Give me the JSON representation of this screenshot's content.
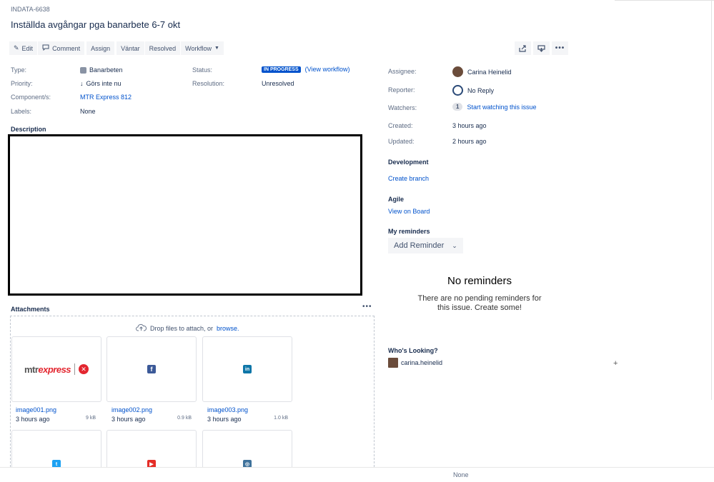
{
  "issue": {
    "key": "INDATA-6638",
    "title": "Inställda avgångar pga banarbete 6-7 okt"
  },
  "toolbar": {
    "edit": "Edit",
    "comment": "Comment",
    "assign": "Assign",
    "vantar": "Väntar",
    "resolved": "Resolved",
    "workflow": "Workflow"
  },
  "details": {
    "type_label": "Type:",
    "type_value": "Banarbeten",
    "priority_label": "Priority:",
    "priority_value": "Görs inte nu",
    "components_label": "Component/s:",
    "components_value": "MTR Express 812",
    "labels_label": "Labels:",
    "labels_value": "None",
    "status_label": "Status:",
    "status_value": "IN PROGRESS",
    "view_workflow": "(View workflow)",
    "resolution_label": "Resolution:",
    "resolution_value": "Unresolved"
  },
  "description": {
    "title": "Description"
  },
  "attachments": {
    "title": "Attachments",
    "drop_text": "Drop files to attach, or",
    "browse": "browse.",
    "files": [
      {
        "name": "image001.png",
        "time": "3 hours ago",
        "size": "9 kB",
        "logo": "mtr express"
      },
      {
        "name": "image002.png",
        "time": "3 hours ago",
        "size": "0.9 kB",
        "logo": "f"
      },
      {
        "name": "image003.png",
        "time": "3 hours ago",
        "size": "1.0 kB",
        "logo": "in"
      }
    ]
  },
  "people": {
    "assignee_label": "Assignee:",
    "assignee": "Carina Heinelid",
    "reporter_label": "Reporter:",
    "reporter": "No Reply",
    "watchers_label": "Watchers:",
    "watchers_count": "1",
    "watch_link": "Start watching this issue"
  },
  "dates": {
    "created_label": "Created:",
    "created": "3 hours ago",
    "updated_label": "Updated:",
    "updated": "2 hours ago"
  },
  "development": {
    "title": "Development",
    "create_branch": "Create branch"
  },
  "agile": {
    "title": "Agile",
    "view_on_board": "View on Board"
  },
  "reminders": {
    "title": "My reminders",
    "add_button": "Add Reminder",
    "empty_title": "No reminders",
    "empty_text": "There are no pending reminders for this issue. Create some!"
  },
  "whos_looking": {
    "title": "Who's Looking?",
    "viewer": "carina.heinelid"
  },
  "footer": {
    "none": "None"
  },
  "colors": {
    "status": "#0052cc",
    "link": "#0052cc",
    "mtr_red": "#e3262f"
  }
}
